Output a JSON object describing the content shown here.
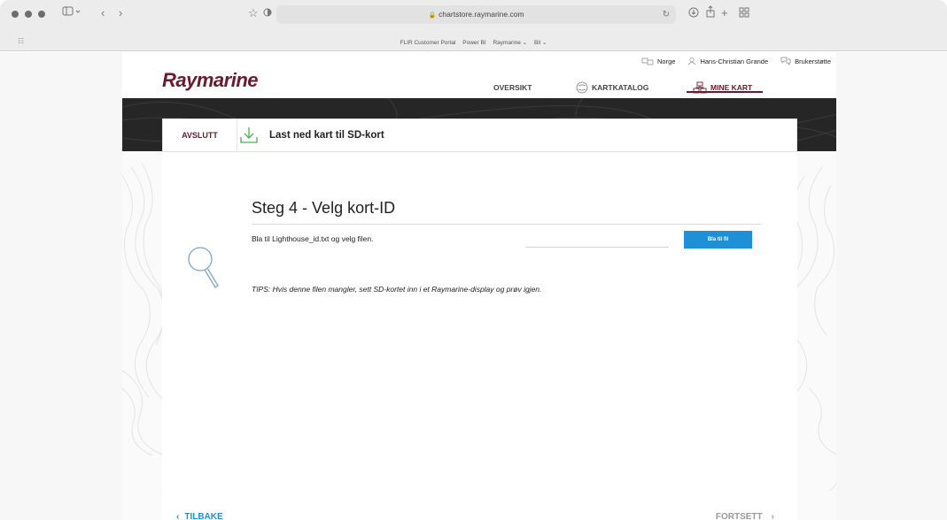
{
  "browser": {
    "url": "chartstore.raymarine.com",
    "bookmarks": [
      "FLIR Customer Portal",
      "Power BI",
      "Raymarine ⌄",
      "Bil ⌄"
    ],
    "tab_grid_glyph": "☷"
  },
  "header": {
    "logo": "Raymarine",
    "utility": {
      "region": "Norge",
      "user": "Hans-Christian Grande",
      "support": "Brukerstøtte"
    },
    "nav": {
      "overview": "OVERSIKT",
      "catalog": "KARTKATALOG",
      "my_charts": "MINE KART"
    }
  },
  "toolbar": {
    "exit_label": "AVSLUTT",
    "title": "Last ned kart til SD-kort"
  },
  "step": {
    "number": "Steg 4",
    "title": " - Velg kort-ID",
    "instruction": "Bla til Lighthouse_id.txt og velg filen.",
    "file_value": "",
    "browse_label": "Bla til fil",
    "tips": "TIPS: Hvis denne filen mangler, sett SD-kortet inn i et Raymarine-display og prøv igjen."
  },
  "footer": {
    "back_label": "TILBAKE",
    "next_label": "FORTSETT"
  },
  "colors": {
    "brand": "#6b1a2e",
    "accent": "#1f8fd6",
    "download_icon": "#4caf50"
  },
  "icons": [
    "sidebar-icon",
    "back-icon",
    "forward-icon",
    "star-icon",
    "shield-icon",
    "reload-icon",
    "download-icon",
    "share-icon",
    "new-tab-icon",
    "tab-overview-icon",
    "globe-icon",
    "user-icon",
    "support-icon",
    "catalog-icon",
    "my-charts-icon",
    "magnifier-icon"
  ]
}
